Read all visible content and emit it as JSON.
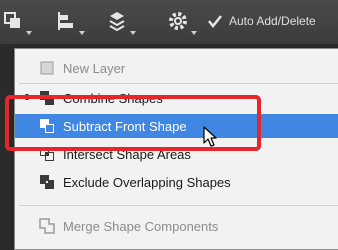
{
  "toolbar": {
    "icons": [
      "path-operations-icon",
      "path-alignment-icon",
      "path-arrangement-icon",
      "gear-icon"
    ],
    "auto_add_delete": {
      "label": "Auto Add/Delete",
      "checked": true
    }
  },
  "menu": {
    "items": [
      {
        "label": "New Layer",
        "icon": "new-layer-icon",
        "enabled": false,
        "selected": false
      },
      {
        "label": "Combine Shapes",
        "icon": "combine-shapes-icon",
        "enabled": true,
        "selected": false,
        "current": true
      },
      {
        "label": "Subtract Front Shape",
        "icon": "subtract-front-shape-icon",
        "enabled": true,
        "selected": true
      },
      {
        "label": "Intersect Shape Areas",
        "icon": "intersect-shape-areas-icon",
        "enabled": true,
        "selected": false
      },
      {
        "label": "Exclude Overlapping Shapes",
        "icon": "exclude-overlapping-shapes-icon",
        "enabled": true,
        "selected": false
      },
      {
        "label": "Merge Shape Components",
        "icon": "merge-shape-components-icon",
        "enabled": false,
        "selected": false
      }
    ]
  },
  "colors": {
    "selection": "#3f87e3",
    "annotation_box": "#e5262b",
    "menu_bg": "#f2f2f2",
    "toolbar_bg": "#3c3c3c"
  }
}
